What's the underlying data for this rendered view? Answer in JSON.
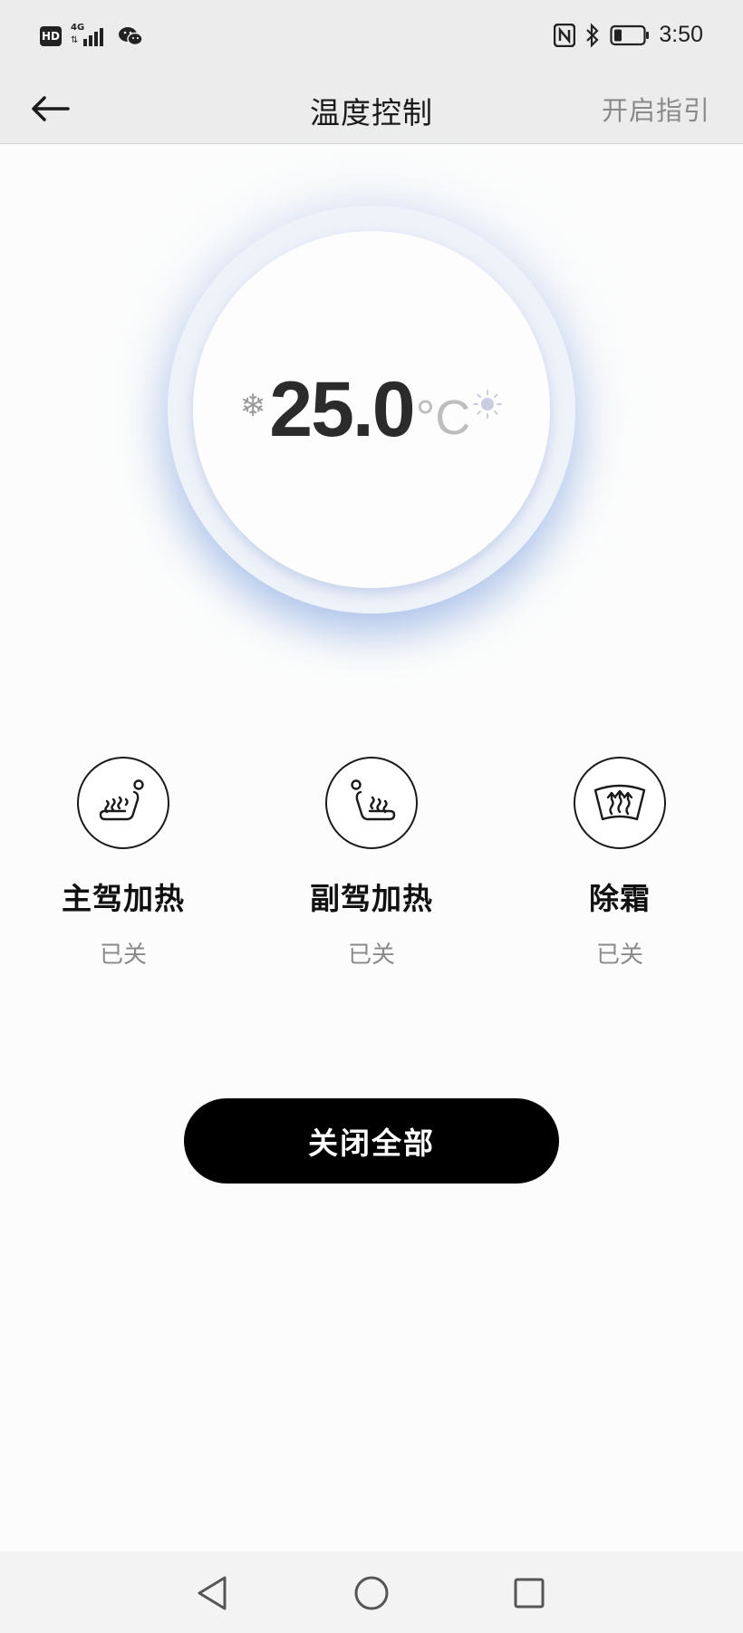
{
  "status_bar": {
    "hd_label": "HD",
    "network_label": "4G",
    "icons": [
      "hd-icon",
      "signal-icon",
      "wechat-icon",
      "nfc-icon",
      "bluetooth-icon",
      "battery-icon"
    ],
    "time": "3:50"
  },
  "header": {
    "back_icon": "arrow-left-icon",
    "title": "温度控制",
    "guide_label": "开启指引"
  },
  "climate": {
    "temperature": "25.0",
    "unit": "°C",
    "cool_icon": "snowflake-icon",
    "heat_icon": "sun-icon",
    "accent_color": "#9bb6e6"
  },
  "controls": [
    {
      "label": "主驾加热",
      "state": "已关",
      "icon": "driver-seat-heat-icon"
    },
    {
      "label": "副驾加热",
      "state": "已关",
      "icon": "passenger-seat-heat-icon"
    },
    {
      "label": "除霜",
      "state": "已关",
      "icon": "defrost-icon"
    }
  ],
  "close_all_label": "关闭全部",
  "nav_bar": {
    "icons": [
      "back-triangle-icon",
      "home-circle-icon",
      "recents-square-icon"
    ]
  }
}
